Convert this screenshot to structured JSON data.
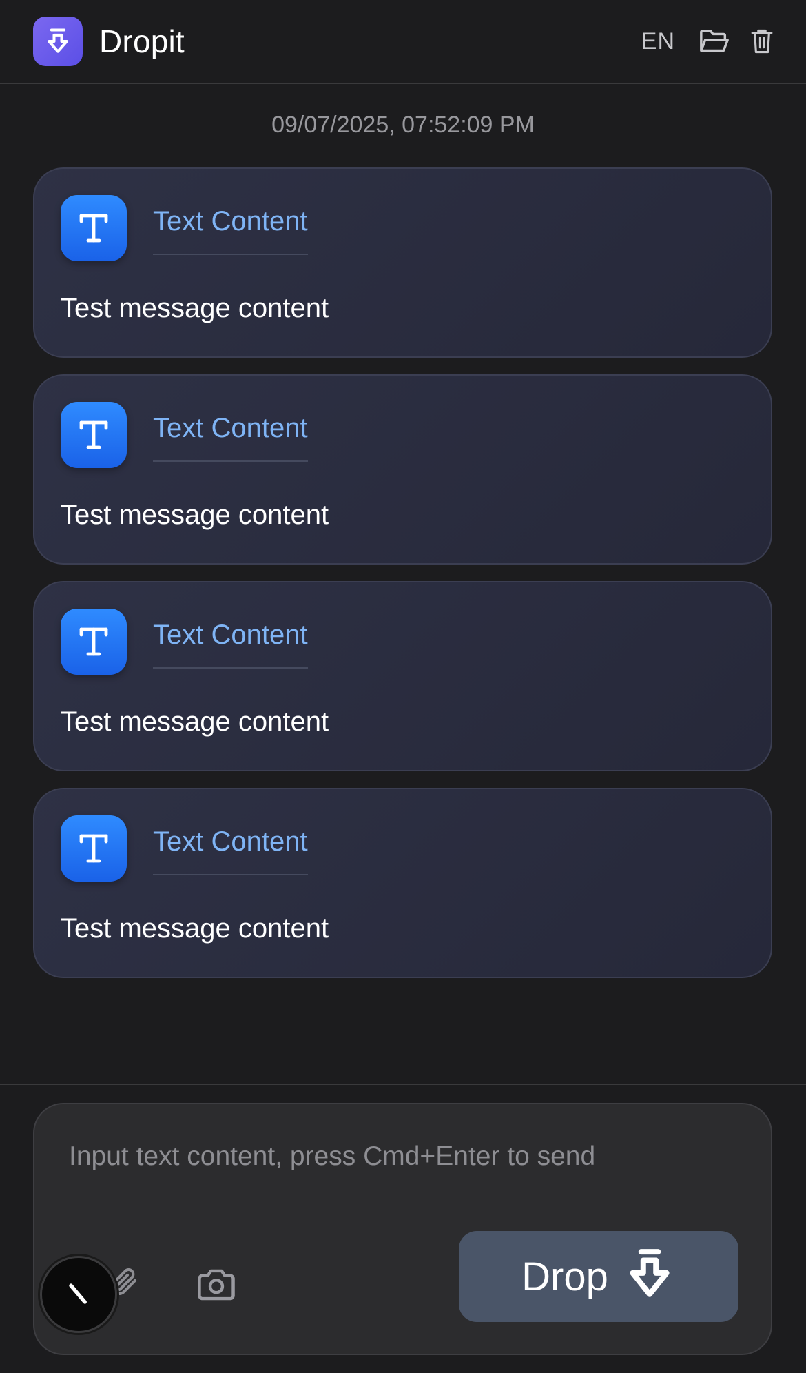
{
  "app": {
    "title": "Dropit"
  },
  "header": {
    "language": "EN"
  },
  "feed": {
    "timestamp": "09/07/2025, 07:52:09 PM",
    "messages": [
      {
        "type_label": "Text Content",
        "text": "Test message content",
        "icon": "text-t-icon"
      },
      {
        "type_label": "Text Content",
        "text": "Test message content",
        "icon": "text-t-icon"
      },
      {
        "type_label": "Text Content",
        "text": "Test message content",
        "icon": "text-t-icon"
      },
      {
        "type_label": "Text Content",
        "text": "Test message content",
        "icon": "text-t-icon"
      }
    ]
  },
  "composer": {
    "placeholder": "Input text content, press Cmd+Enter to send",
    "drop_label": "Drop"
  },
  "colors": {
    "logo_accent": "#6c5ce7",
    "type_icon": "#2577f5",
    "type_label": "#7fb4f5",
    "drop_button": "#4a5568"
  }
}
